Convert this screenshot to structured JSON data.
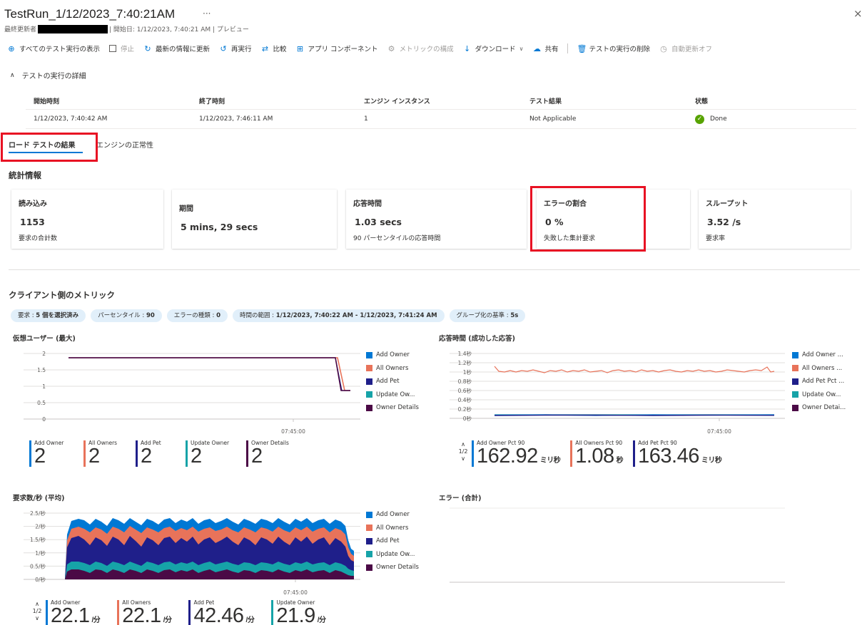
{
  "header": {
    "title": "TestRun_1/12/2023_7:40:21AM",
    "more": "···",
    "close": "×",
    "updated_by_label": "最終更新者",
    "sub_rest": "| 開始日: 1/12/2023, 7:40:21 AM | プレビュー"
  },
  "toolbar": {
    "view_all": "すべてのテスト実行の表示",
    "stop": "停止",
    "refresh": "最新の情報に更新",
    "rerun": "再実行",
    "compare": "比較",
    "app_components": "アプリ コンポーネント",
    "metrics_config": "メトリックの構成",
    "download": "ダウンロード",
    "share": "共有",
    "delete": "テストの実行の削除",
    "autorefresh": "自動更新オフ"
  },
  "details": {
    "section_label": "テストの実行の詳細",
    "headers": [
      "開始時刻",
      "終了時刻",
      "エンジン インスタンス",
      "テスト結果",
      "状態"
    ],
    "row": [
      "1/12/2023, 7:40:42 AM",
      "1/12/2023, 7:46:11 AM",
      "1",
      "Not Applicable",
      "Done"
    ]
  },
  "tabs": {
    "results": "ロード テストの結果",
    "health": "エンジンの正常性"
  },
  "stats": {
    "title": "統計情報",
    "cards": [
      {
        "label": "読み込み",
        "value": "1153",
        "sub": "要求の合計数"
      },
      {
        "label": "期間",
        "value": "5 mins, 29 secs",
        "sub": ""
      },
      {
        "label": "応答時間",
        "value": "1.03 secs",
        "sub": "90 パーセンタイルの応答時間"
      },
      {
        "label": "エラーの割合",
        "value": "0 %",
        "sub": "失敗した集計要求"
      },
      {
        "label": "スループット",
        "value": "3.52 /s",
        "sub": "要求率"
      }
    ]
  },
  "client_metrics": {
    "title": "クライアント側のメトリック",
    "pills": [
      {
        "k": "要求 : ",
        "v": "5 個を選択済み"
      },
      {
        "k": "パーセンタイル : ",
        "v": "90"
      },
      {
        "k": "エラーの種類 : ",
        "v": "0"
      },
      {
        "k": "時間の範囲 : ",
        "v": "1/12/2023, 7:40:22 AM - 1/12/2023, 7:41:24 AM"
      },
      {
        "k": "グループ化の基準 : ",
        "v": "5s"
      }
    ]
  },
  "colors": {
    "add_owner": "#0078d4",
    "all_owners": "#e8735a",
    "add_pet": "#1f1f8a",
    "update_owner": "#16a3a8",
    "owner_details": "#4b0a46"
  },
  "vu_chart": {
    "title": "仮想ユーザー (最大)",
    "legend": [
      "Add Owner",
      "All Owners",
      "Add Pet",
      "Update Ow...",
      "Owner Details"
    ],
    "x_tick": "07:45:00",
    "y_ticks": [
      "2",
      "1.5",
      "1",
      "0.5",
      "0"
    ],
    "big": [
      {
        "label": "Add Owner",
        "value": "2"
      },
      {
        "label": "All Owners",
        "value": "2"
      },
      {
        "label": "Add Pet",
        "value": "2"
      },
      {
        "label": "Update Owner",
        "value": "2"
      },
      {
        "label": "Owner Details",
        "value": "2"
      }
    ]
  },
  "rt_chart": {
    "title": "応答時間 (成功した応答)",
    "legend": [
      "Add Owner ...",
      "All Owners ...",
      "Add Pet Pct ...",
      "Update Ow...",
      "Owner Detai..."
    ],
    "x_tick": "07:45:00",
    "y_ticks": [
      "1.4秒",
      "1.2秒",
      "1秒",
      "0.8秒",
      "0.6秒",
      "0.4秒",
      "0.2秒",
      "0秒"
    ],
    "pager": "1/2",
    "big": [
      {
        "label": "Add Owner Pct 90",
        "value": "162.92",
        "unit": "ミリ秒"
      },
      {
        "label": "All Owners Pct 90",
        "value": "1.08",
        "unit": "秒"
      },
      {
        "label": "Add Pet Pct 90",
        "value": "163.46",
        "unit": "ミリ秒"
      }
    ]
  },
  "rps_chart": {
    "title": "要求数/秒 (平均)",
    "legend": [
      "Add Owner",
      "All Owners",
      "Add Pet",
      "Update Ow...",
      "Owner Details"
    ],
    "x_tick": "07:45:00",
    "y_ticks": [
      "2.5/秒",
      "2/秒",
      "1.5/秒",
      "1/秒",
      "0.5/秒",
      "0/秒"
    ],
    "pager": "1/2",
    "big": [
      {
        "label": "Add Owner",
        "value": "22.1",
        "unit": "/分"
      },
      {
        "label": "All Owners",
        "value": "22.1",
        "unit": "/分"
      },
      {
        "label": "Add Pet",
        "value": "42.46",
        "unit": "/分"
      },
      {
        "label": "Update Owner",
        "value": "21.9",
        "unit": "/分"
      }
    ]
  },
  "err_chart": {
    "title": "エラー (合計)"
  }
}
